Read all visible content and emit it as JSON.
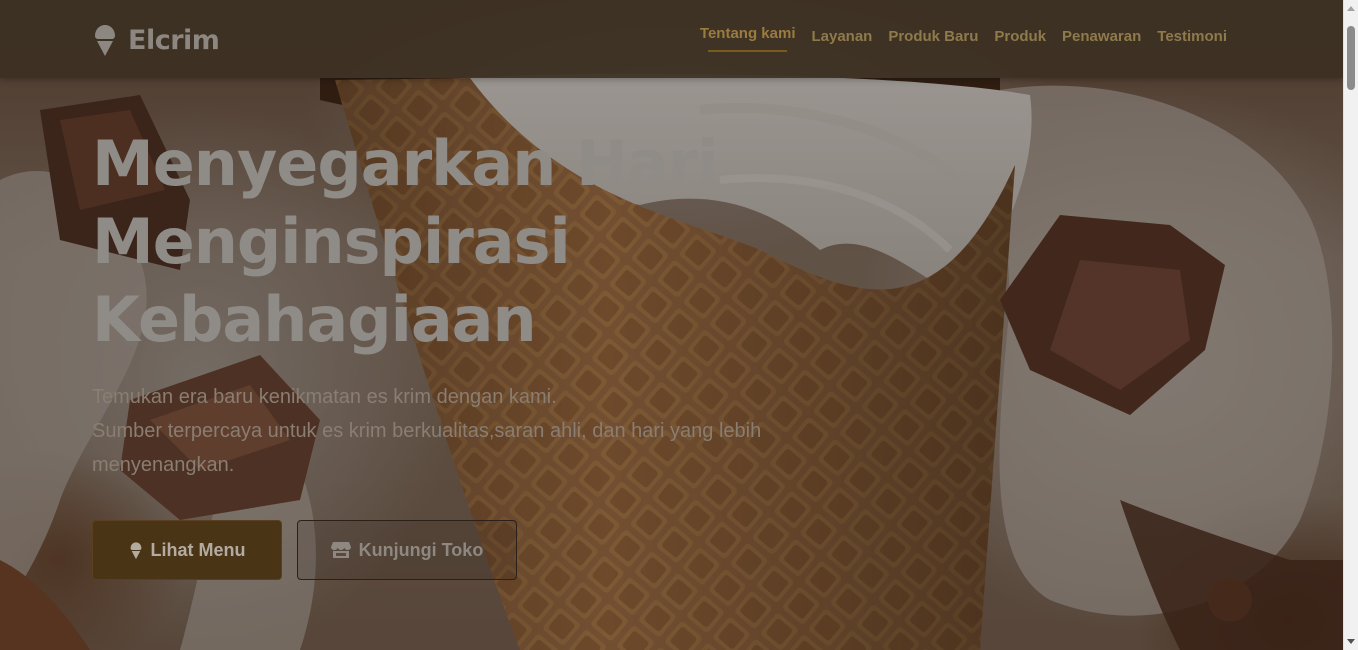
{
  "brand": {
    "name": "Elcrim",
    "icon": "ice-cream-icon"
  },
  "nav": {
    "items": [
      {
        "label": "Tentang kami",
        "active": true
      },
      {
        "label": "Layanan",
        "active": false
      },
      {
        "label": "Produk Baru",
        "active": false
      },
      {
        "label": "Produk",
        "active": false
      },
      {
        "label": "Penawaran",
        "active": false
      },
      {
        "label": "Testimoni",
        "active": false
      }
    ]
  },
  "hero": {
    "title_lines": [
      "Menyegarkan Hari",
      "Menginspirasi",
      "Kebahagiaan"
    ],
    "subtitle_lines": [
      "Temukan era baru kenikmatan es krim dengan kami.",
      "Sumber terpercaya untuk es krim berkualitas,saran ahli, dan hari yang lebih",
      "menyenangkan."
    ],
    "primary_button": {
      "label": "Lihat Menu",
      "icon": "ice-cream-icon"
    },
    "secondary_button": {
      "label": "Kunjungi Toko",
      "icon": "store-icon"
    },
    "background_image": "ice-cream-cone-with-chocolate-and-milk-splash"
  },
  "colors": {
    "accent": "#9b7c40",
    "primary_button_bg": "#4a3416",
    "navbar_bg": "#3c3022"
  }
}
